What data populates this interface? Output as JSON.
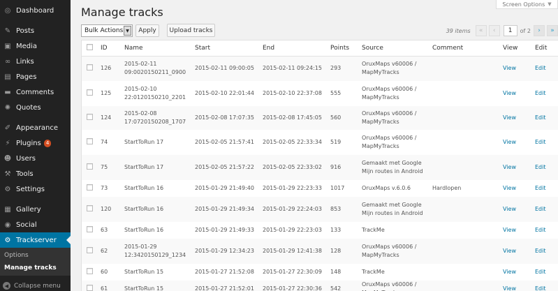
{
  "sidebar": {
    "items": [
      {
        "label": "Dashboard",
        "icon": "dashboard-icon",
        "glyph": "◎"
      },
      {
        "label": "Posts",
        "icon": "pushpin-icon",
        "glyph": "✎"
      },
      {
        "label": "Media",
        "icon": "media-icon",
        "glyph": "▣"
      },
      {
        "label": "Links",
        "icon": "links-icon",
        "glyph": "∞"
      },
      {
        "label": "Pages",
        "icon": "pages-icon",
        "glyph": "▤"
      },
      {
        "label": "Comments",
        "icon": "comments-icon",
        "glyph": "▬"
      },
      {
        "label": "Quotes",
        "icon": "quotes-icon",
        "glyph": "✺"
      },
      {
        "label": "Appearance",
        "icon": "appearance-icon",
        "glyph": "✐"
      },
      {
        "label": "Plugins",
        "icon": "plugins-icon",
        "glyph": "⚡",
        "badge": "4"
      },
      {
        "label": "Users",
        "icon": "users-icon",
        "glyph": "☻"
      },
      {
        "label": "Tools",
        "icon": "tools-icon",
        "glyph": "⚒"
      },
      {
        "label": "Settings",
        "icon": "settings-icon",
        "glyph": "⚙"
      },
      {
        "label": "Gallery",
        "icon": "gallery-icon",
        "glyph": "▦"
      },
      {
        "label": "Social",
        "icon": "social-icon",
        "glyph": "◉"
      },
      {
        "label": "Trackserver",
        "icon": "trackserver-icon",
        "glyph": "⚙",
        "active": true
      }
    ],
    "submenu": [
      {
        "label": "Options"
      },
      {
        "label": "Manage tracks",
        "current": true
      }
    ],
    "collapse_label": "Collapse menu",
    "collapse_glyph": "◀"
  },
  "header": {
    "title": "Manage tracks",
    "screen_options": "Screen Options",
    "screen_options_arrow": "▼"
  },
  "toolbar": {
    "bulk_actions": "Bulk Actions",
    "bulk_arrow": "▼",
    "apply": "Apply",
    "upload": "Upload tracks"
  },
  "pagination": {
    "items": "39 items",
    "first": "«",
    "prev": "‹",
    "current": "1",
    "of": "of 2",
    "next": "›",
    "last": "»"
  },
  "table": {
    "columns": [
      "ID",
      "Name",
      "Start",
      "End",
      "Points",
      "Source",
      "Comment",
      "View",
      "Edit"
    ],
    "rows": [
      {
        "id": "126",
        "name": [
          "2015-02-11",
          "09:0020150211_0900"
        ],
        "start": "2015-02-11 09:00:05",
        "end": "2015-02-11 09:24:15",
        "points": "293",
        "source": [
          "OruxMaps v60006 /",
          "MapMyTracks"
        ],
        "comment": "",
        "view": "View",
        "edit": "Edit"
      },
      {
        "id": "125",
        "name": [
          "2015-02-10",
          "22:0120150210_2201"
        ],
        "start": "2015-02-10 22:01:44",
        "end": "2015-02-10 22:37:08",
        "points": "555",
        "source": [
          "OruxMaps v60006 /",
          "MapMyTracks"
        ],
        "comment": "",
        "view": "View",
        "edit": "Edit"
      },
      {
        "id": "124",
        "name": [
          "2015-02-08",
          "17:0720150208_1707"
        ],
        "start": "2015-02-08 17:07:35",
        "end": "2015-02-08 17:45:05",
        "points": "560",
        "source": [
          "OruxMaps v60006 /",
          "MapMyTracks"
        ],
        "comment": "",
        "view": "View",
        "edit": "Edit"
      },
      {
        "id": "74",
        "name": [
          "StartToRun 17"
        ],
        "start": "2015-02-05 21:57:41",
        "end": "2015-02-05 22:33:34",
        "points": "519",
        "source": [
          "OruxMaps v60006 /",
          "MapMyTracks"
        ],
        "comment": "",
        "view": "View",
        "edit": "Edit"
      },
      {
        "id": "75",
        "name": [
          "StartToRun 17"
        ],
        "start": "2015-02-05 21:57:22",
        "end": "2015-02-05 22:33:02",
        "points": "916",
        "source": [
          "Gemaakt met Google",
          "Mijn routes in Android"
        ],
        "comment": "",
        "view": "View",
        "edit": "Edit"
      },
      {
        "id": "73",
        "name": [
          "StartToRun 16"
        ],
        "start": "2015-01-29 21:49:40",
        "end": "2015-01-29 22:23:33",
        "points": "1017",
        "source": [
          "OruxMaps v.6.0.6"
        ],
        "comment": "Hardlopen",
        "view": "View",
        "edit": "Edit"
      },
      {
        "id": "120",
        "name": [
          "StartToRun 16"
        ],
        "start": "2015-01-29 21:49:34",
        "end": "2015-01-29 22:24:03",
        "points": "853",
        "source": [
          "Gemaakt met Google",
          "Mijn routes in Android"
        ],
        "comment": "",
        "view": "View",
        "edit": "Edit"
      },
      {
        "id": "63",
        "name": [
          "StartToRun 16"
        ],
        "start": "2015-01-29 21:49:33",
        "end": "2015-01-29 22:23:03",
        "points": "133",
        "source": [
          "TrackMe"
        ],
        "comment": "",
        "view": "View",
        "edit": "Edit"
      },
      {
        "id": "62",
        "name": [
          "2015-01-29",
          "12:3420150129_1234"
        ],
        "start": "2015-01-29 12:34:23",
        "end": "2015-01-29 12:41:38",
        "points": "128",
        "source": [
          "OruxMaps v60006 /",
          "MapMyTracks"
        ],
        "comment": "",
        "view": "View",
        "edit": "Edit"
      },
      {
        "id": "60",
        "name": [
          "StartToRun 15"
        ],
        "start": "2015-01-27 21:52:08",
        "end": "2015-01-27 22:30:09",
        "points": "148",
        "source": [
          "TrackMe"
        ],
        "comment": "",
        "view": "View",
        "edit": "Edit"
      },
      {
        "id": "61",
        "name": [
          "StartToRun 15"
        ],
        "start": "2015-01-27 21:52:01",
        "end": "2015-01-27 22:30:36",
        "points": "542",
        "source": [
          "OruxMaps v60006 /",
          "MapMyTracks"
        ],
        "comment": "",
        "view": "View",
        "edit": "Edit"
      }
    ]
  }
}
